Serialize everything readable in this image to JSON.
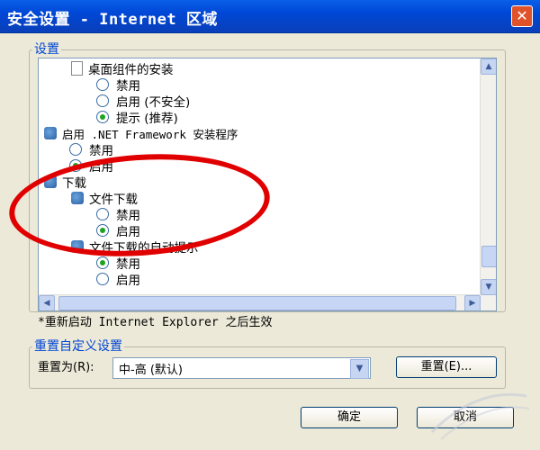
{
  "window": {
    "title": "安全设置 - Internet 区域",
    "close_glyph": "✕"
  },
  "settings_group": {
    "label": "设置",
    "items": [
      {
        "type": "header",
        "icon": "page-icon",
        "label": "桌面组件的安装"
      },
      {
        "type": "radio",
        "label": "禁用",
        "selected": false
      },
      {
        "type": "radio",
        "label": "启用 (不安全)",
        "selected": false
      },
      {
        "type": "radio",
        "label": "提示 (推荐)",
        "selected": true
      },
      {
        "type": "header",
        "icon": "settings-icon",
        "label": "启用 .NET Framework 安装程序"
      },
      {
        "type": "radio",
        "label": "禁用",
        "selected": false
      },
      {
        "type": "radio",
        "label": "启用",
        "selected": true
      },
      {
        "type": "header",
        "icon": "settings-icon",
        "label": "下载"
      },
      {
        "type": "subheader",
        "icon": "settings-icon",
        "label": "文件下载"
      },
      {
        "type": "radio",
        "label": "禁用",
        "selected": false
      },
      {
        "type": "radio",
        "label": "启用",
        "selected": true
      },
      {
        "type": "subheader",
        "icon": "settings-icon",
        "label": "文件下载的自动提示"
      },
      {
        "type": "radio",
        "label": "禁用",
        "selected": true
      },
      {
        "type": "radio",
        "label": "启用",
        "selected": false
      }
    ],
    "scroll_up": "▲",
    "scroll_down": "▼",
    "scroll_left": "◀",
    "scroll_right": "▶"
  },
  "restart_note": "*重新启动 Internet Explorer 之后生效",
  "reset_group": {
    "label": "重置自定义设置",
    "reset_to_label": "重置为(R):",
    "selected_level": "中-高 (默认)",
    "dropdown_glyph": "▼",
    "reset_button": "重置(E)..."
  },
  "buttons": {
    "ok": "确定",
    "cancel": "取消"
  },
  "colors": {
    "title_bar": "#0047d6",
    "annotation": "#e00000",
    "group_label": "#0046d5"
  }
}
